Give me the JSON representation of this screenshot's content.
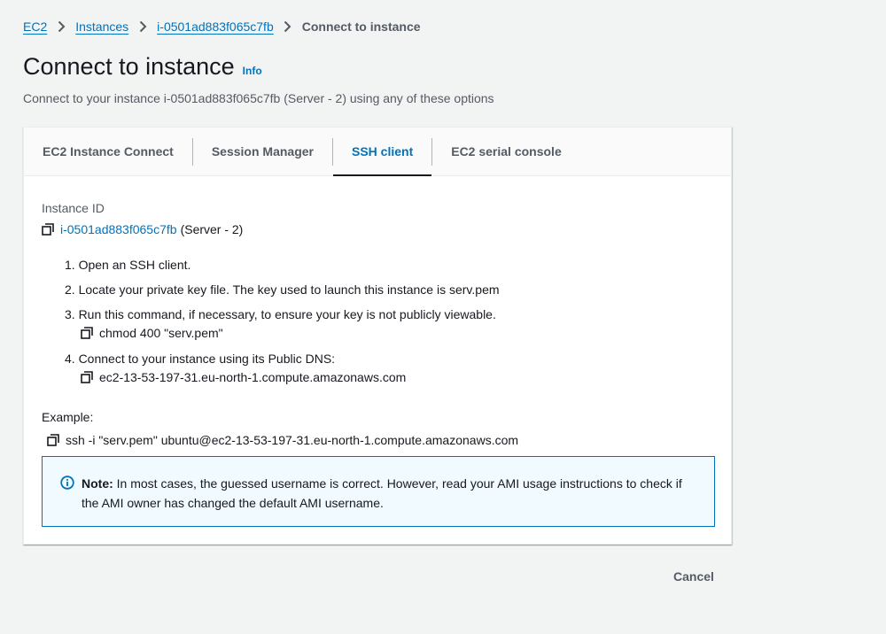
{
  "breadcrumb": {
    "items": [
      "EC2",
      "Instances",
      "i-0501ad883f065c7fb"
    ],
    "current": "Connect to instance"
  },
  "header": {
    "title": "Connect to instance",
    "info": "Info",
    "subtitle": "Connect to your instance i-0501ad883f065c7fb (Server - 2) using any of these options"
  },
  "tabs": [
    {
      "label": "EC2 Instance Connect",
      "active": false
    },
    {
      "label": "Session Manager",
      "active": false
    },
    {
      "label": "SSH client",
      "active": true
    },
    {
      "label": "EC2 serial console",
      "active": false
    }
  ],
  "instance": {
    "label": "Instance ID",
    "id": "i-0501ad883f065c7fb",
    "name": "(Server - 2)"
  },
  "steps": [
    {
      "text": "1. Open an SSH client.",
      "command": ""
    },
    {
      "text": "2. Locate your private key file. The key used to launch this instance is serv.pem",
      "command": ""
    },
    {
      "text": "3. Run this command, if necessary, to ensure your key is not publicly viewable.",
      "command": "chmod 400 \"serv.pem\""
    },
    {
      "text": "4. Connect to your instance using its Public DNS:",
      "command": "ec2-13-53-197-31.eu-north-1.compute.amazonaws.com"
    }
  ],
  "example": {
    "label": "Example:",
    "command": "ssh -i \"serv.pem\" ubuntu@ec2-13-53-197-31.eu-north-1.compute.amazonaws.com"
  },
  "note": {
    "bold": "Note:",
    "text": " In most cases, the guessed username is correct. However, read your AMI usage instructions to check if the AMI owner has changed the default AMI username."
  },
  "footer": {
    "cancel_label": "Cancel"
  },
  "colors": {
    "link": "#0073bb",
    "background": "#f2f3f3",
    "note_background": "#f1faff"
  }
}
